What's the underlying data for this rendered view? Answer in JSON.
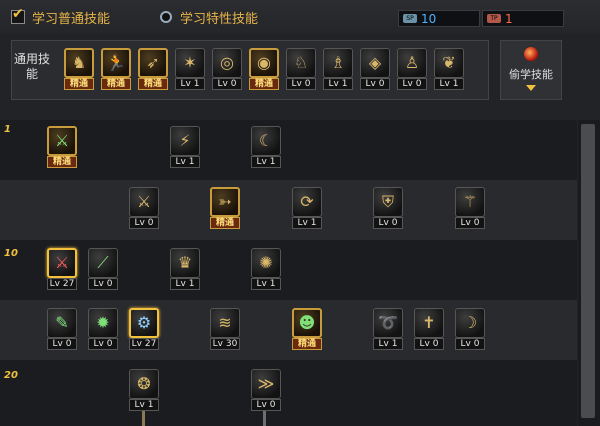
{
  "tabs": {
    "normal": "学习普通技能",
    "trait": "学习特性技能"
  },
  "points": {
    "sp_tag": "SP",
    "sp_value": "10",
    "tp_tag": "TP",
    "tp_value": "1"
  },
  "common": {
    "label": "通用技能",
    "skills": [
      {
        "icon": "crouch-figure-icon",
        "glyph": "♞",
        "level": "精通",
        "mastered": true
      },
      {
        "icon": "leap-figure-icon",
        "glyph": "🏃",
        "level": "精通",
        "mastered": true
      },
      {
        "icon": "sprint-figure-icon",
        "glyph": "➶",
        "level": "精通",
        "mastered": true
      },
      {
        "icon": "golden-wings-icon",
        "glyph": "✶",
        "level": "Lv 1",
        "mastered": false
      },
      {
        "icon": "green-target-icon",
        "glyph": "◎",
        "level": "Lv 0",
        "mastered": false
      },
      {
        "icon": "green-target-master-icon",
        "glyph": "◉",
        "level": "精通",
        "mastered": true
      },
      {
        "icon": "green-rider-icon",
        "glyph": "♘",
        "level": "Lv 0",
        "mastered": false
      },
      {
        "icon": "green-archer-icon",
        "glyph": "♗",
        "level": "Lv 1",
        "mastered": false
      },
      {
        "icon": "golden-eye-icon",
        "glyph": "◈",
        "level": "Lv 0",
        "mastered": false
      },
      {
        "icon": "golden-strongman-icon",
        "glyph": "♙",
        "level": "Lv 0",
        "mastered": false
      },
      {
        "icon": "green-spirit-icon",
        "glyph": "❦",
        "level": "Lv 1",
        "mastered": false
      }
    ]
  },
  "steal": {
    "label": "偷学技能"
  },
  "tree": {
    "row_labels": [
      "1",
      "10",
      "20"
    ],
    "skills": [
      {
        "icon": "green-slash-master-icon",
        "glyph": "⚔",
        "level": "精通",
        "mastered": true,
        "color": "green"
      },
      {
        "icon": "claw-slash-icon",
        "glyph": "⚡",
        "level": "Lv 1",
        "mastered": false,
        "color": "gold"
      },
      {
        "icon": "crescent-slash-icon",
        "glyph": "☾",
        "level": "Lv 1",
        "mastered": false,
        "color": "gold"
      },
      {
        "icon": "double-sword-icon",
        "glyph": "⚔",
        "level": "Lv 0",
        "mastered": false,
        "color": "gold"
      },
      {
        "icon": "arrow-dash-master-icon",
        "glyph": "➳",
        "level": "精通",
        "mastered": true,
        "color": "gold"
      },
      {
        "icon": "spiral-slash-icon",
        "glyph": "⟳",
        "level": "Lv 1",
        "mastered": false,
        "color": "gold"
      },
      {
        "icon": "shield-icon",
        "glyph": "⛨",
        "level": "Lv 0",
        "mastered": false,
        "color": "gold"
      },
      {
        "icon": "triple-sword-icon",
        "glyph": "⚚",
        "level": "Lv 0",
        "mastered": false,
        "color": "gold"
      },
      {
        "icon": "red-blade-icon",
        "glyph": "⚔",
        "level": "Lv 27",
        "mastered": false,
        "color": "red",
        "selected": true
      },
      {
        "icon": "green-blade-icon",
        "glyph": "⟋",
        "level": "Lv 0",
        "mastered": false,
        "color": "green"
      },
      {
        "icon": "crown-burst-icon",
        "glyph": "♛",
        "level": "Lv 1",
        "mastered": false,
        "color": "gold"
      },
      {
        "icon": "vortex-icon",
        "glyph": "✺",
        "level": "Lv 1",
        "mastered": false,
        "color": "gold"
      },
      {
        "icon": "green-scroll-icon",
        "glyph": "✎",
        "level": "Lv 0",
        "mastered": false,
        "color": "green"
      },
      {
        "icon": "green-burst-icon",
        "glyph": "✹",
        "level": "Lv 0",
        "mastered": false,
        "color": "green"
      },
      {
        "icon": "blue-gears-icon",
        "glyph": "⚙",
        "level": "Lv 27",
        "mastered": false,
        "color": "blue",
        "selected": true
      },
      {
        "icon": "golden-wave-icon",
        "glyph": "≋",
        "level": "Lv 30",
        "mastered": false,
        "color": "gold"
      },
      {
        "icon": "green-head-master-icon",
        "glyph": "☻",
        "level": "精通",
        "mastered": true,
        "color": "green"
      },
      {
        "icon": "swirl-slash-icon",
        "glyph": "➰",
        "level": "Lv 1",
        "mastered": false,
        "color": "gold"
      },
      {
        "icon": "cross-blade-icon",
        "glyph": "✝",
        "level": "Lv 0",
        "mastered": false,
        "color": "gold"
      },
      {
        "icon": "moon-arc-icon",
        "glyph": "☽",
        "level": "Lv 0",
        "mastered": false,
        "color": "gold"
      },
      {
        "icon": "rune-seal-icon",
        "glyph": "❂",
        "level": "Lv 1",
        "mastered": false,
        "color": "gold"
      },
      {
        "icon": "arc-wave-icon",
        "glyph": "≫",
        "level": "Lv 0",
        "mastered": false,
        "color": "gold"
      }
    ]
  }
}
